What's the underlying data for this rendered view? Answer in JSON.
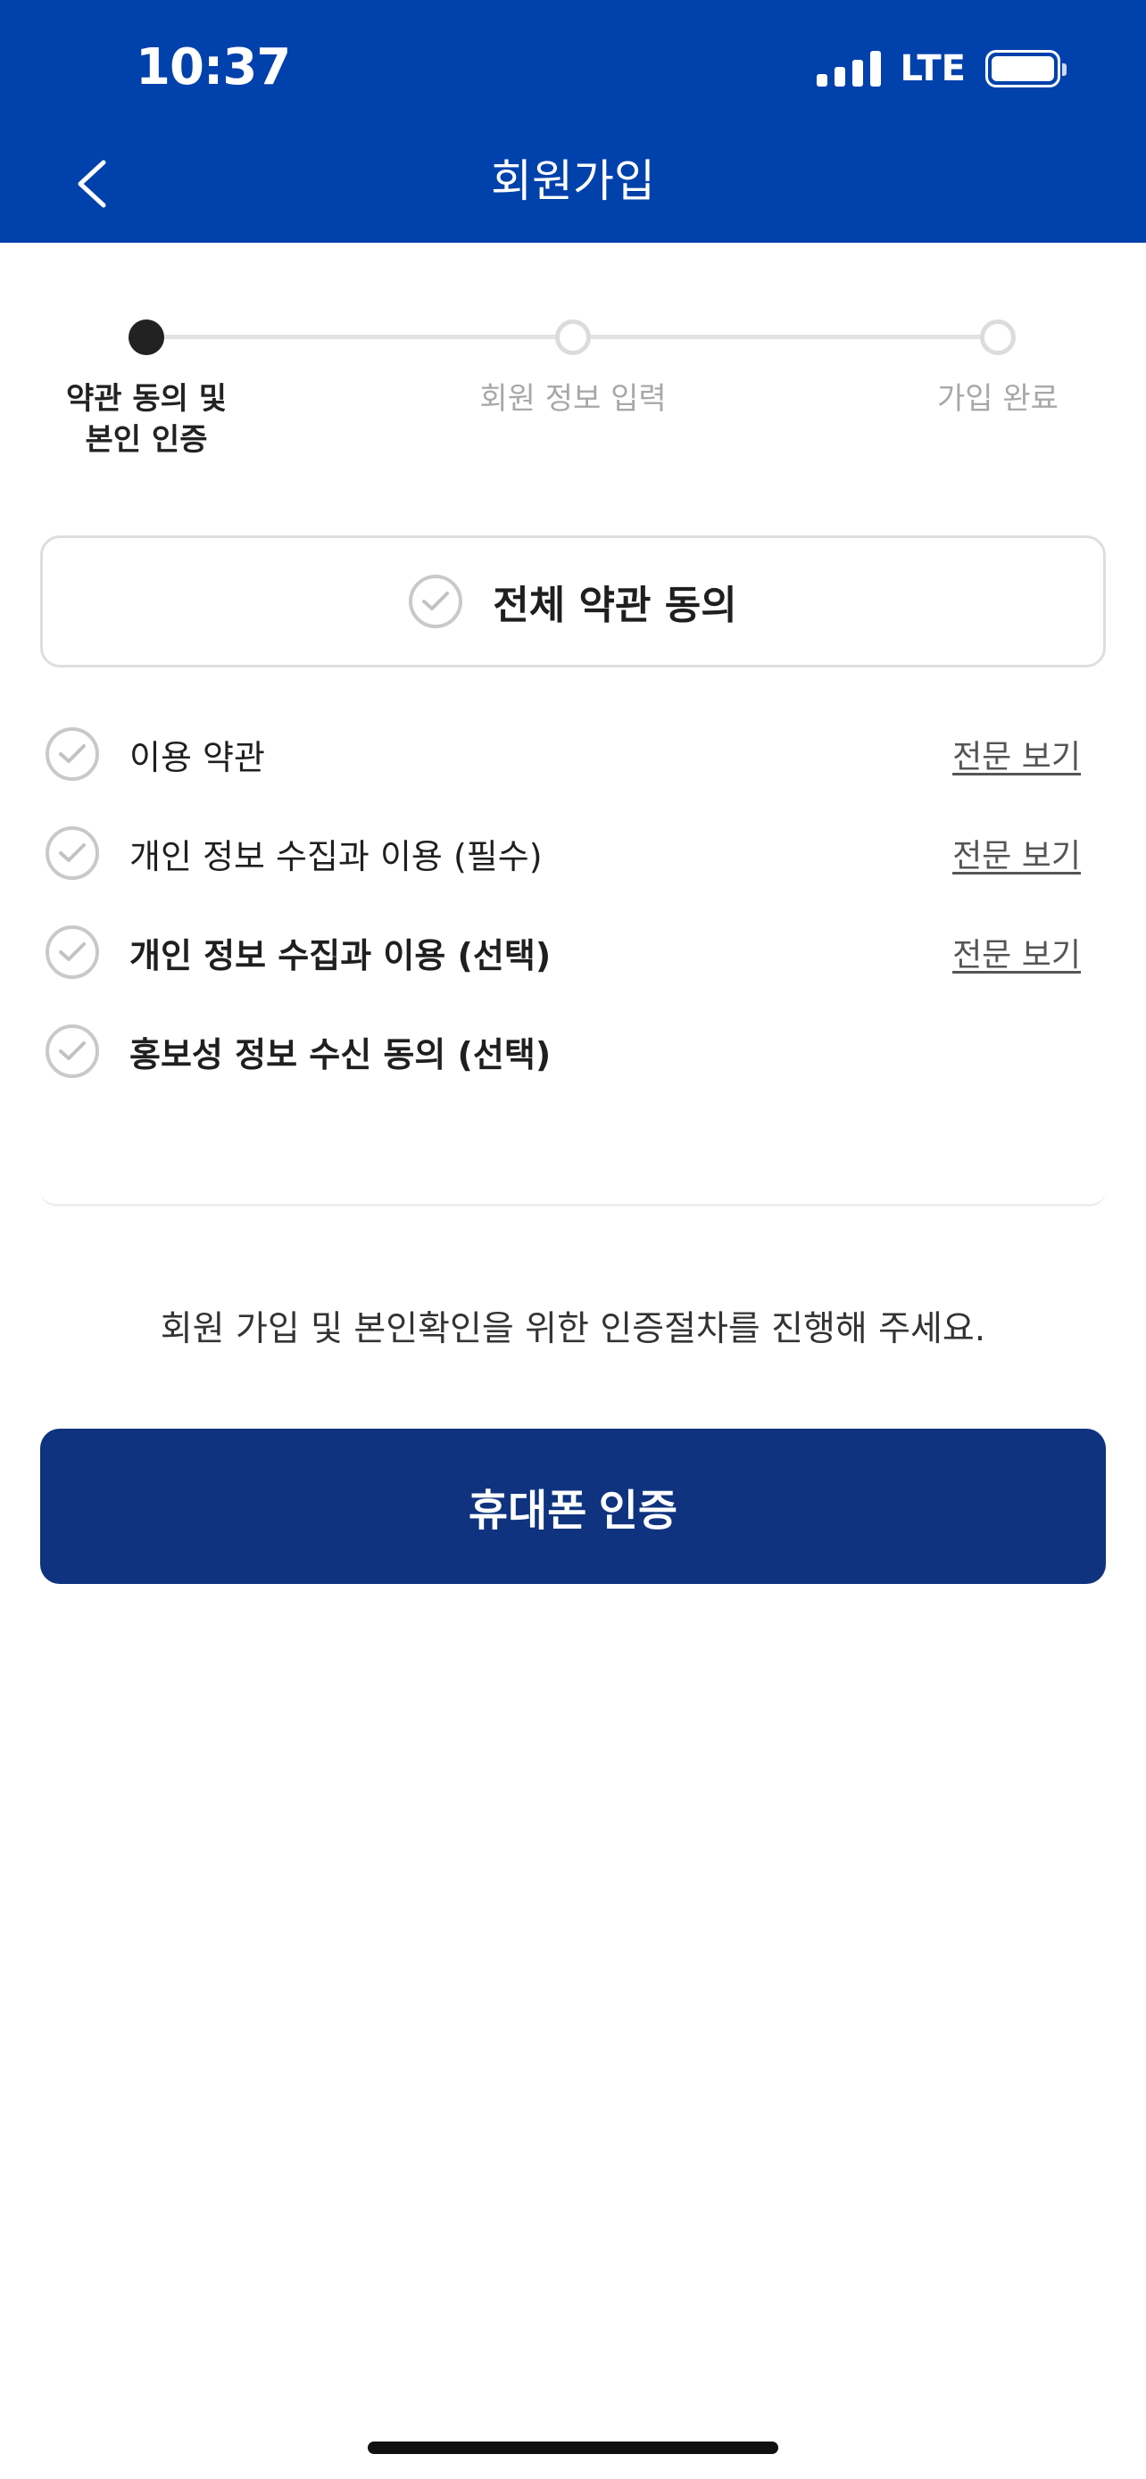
{
  "status_bar": {
    "time": "10:37",
    "network": "LTE"
  },
  "header": {
    "title": "회원가입",
    "back_icon": "chevron-left-icon"
  },
  "stepper": {
    "steps": [
      {
        "label": "약관 동의 및\n본인 인증",
        "state": "active"
      },
      {
        "label": "회원 정보 입력",
        "state": "inactive"
      },
      {
        "label": "가입 완료",
        "state": "inactive"
      }
    ]
  },
  "agreement": {
    "all_label": "전체 약관 동의",
    "items": [
      {
        "label": "이용 약관",
        "link": "전문 보기"
      },
      {
        "label": "개인 정보 수집과 이용 (필수)",
        "link": "전문 보기"
      },
      {
        "label": "개인 정보 수집과 이용 (선택)",
        "link": "전문 보기"
      },
      {
        "label": "홍보성 정보 수신 동의 (선택)",
        "link": ""
      }
    ]
  },
  "auth": {
    "description": "회원 가입 및 본인확인을 위한 인증절차를 진행해 주세요.",
    "button_label": "휴대폰 인증"
  },
  "colors": {
    "header_bg": "#0041ab",
    "primary_button": "#0f337e",
    "check_gray": "#c9c9c9"
  }
}
